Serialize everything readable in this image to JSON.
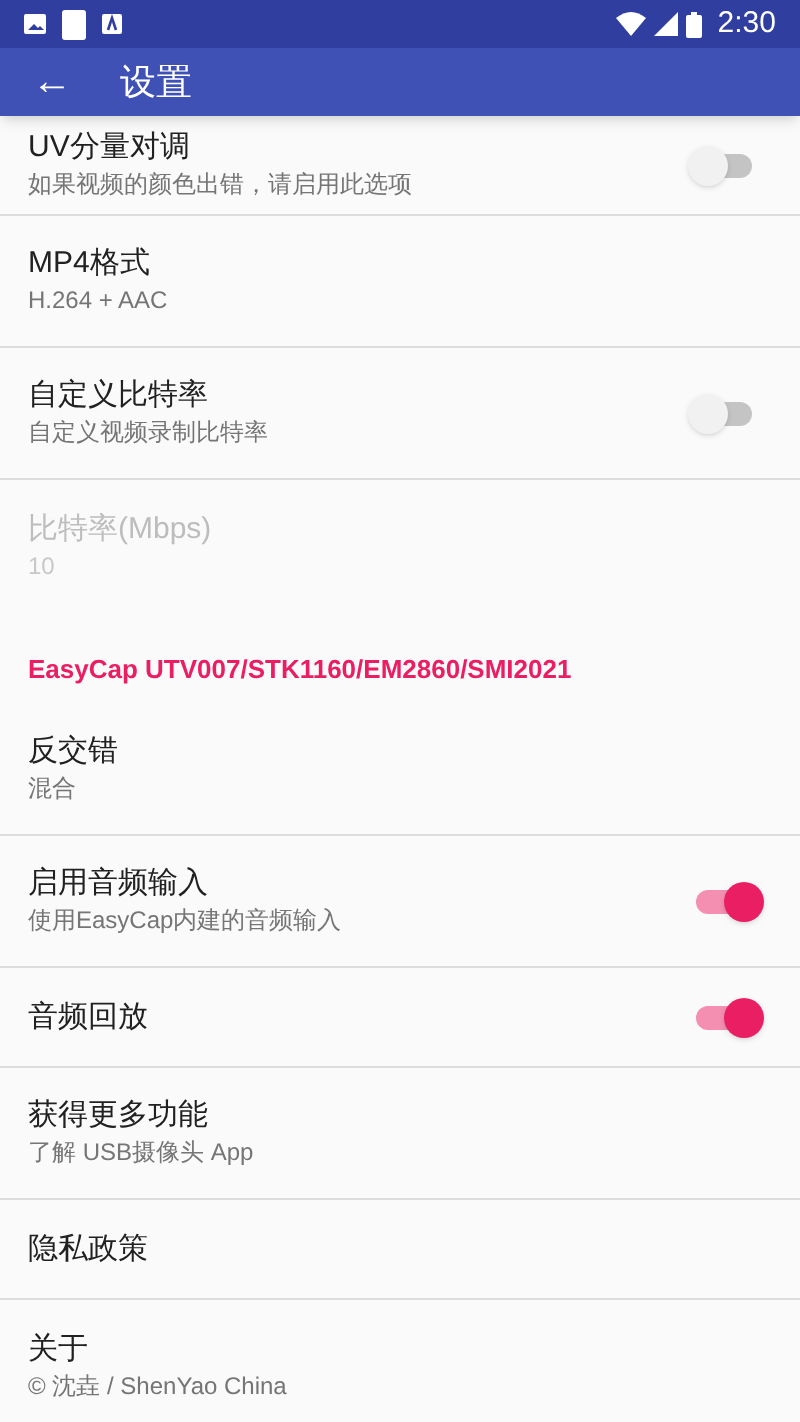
{
  "status_bar": {
    "time": "2:30"
  },
  "app_bar": {
    "back": "←",
    "title": "设置"
  },
  "items": [
    {
      "kind": "switch",
      "title": "UV分量对调",
      "summary": "如果视频的颜色出错，请启用此选项",
      "on": false,
      "disabled": false
    },
    {
      "kind": "text",
      "title": "MP4格式",
      "summary": "H.264 + AAC",
      "disabled": false
    },
    {
      "kind": "switch",
      "title": "自定义比特率",
      "summary": "自定义视频录制比特率",
      "on": false,
      "disabled": false
    },
    {
      "kind": "text",
      "title": "比特率(Mbps)",
      "summary": "10",
      "disabled": true
    },
    {
      "kind": "category",
      "title": "EasyCap UTV007/STK1160/EM2860/SMI2021"
    },
    {
      "kind": "text",
      "title": "反交错",
      "summary": "混合",
      "disabled": false
    },
    {
      "kind": "switch",
      "title": "启用音频输入",
      "summary": "使用EasyCap内建的音频输入",
      "on": true,
      "disabled": false
    },
    {
      "kind": "switch",
      "title": "音频回放",
      "on": true,
      "disabled": false
    },
    {
      "kind": "text",
      "title": "获得更多功能",
      "summary": "了解 USB摄像头 App",
      "disabled": false
    },
    {
      "kind": "text",
      "title": "隐私政策",
      "disabled": false
    },
    {
      "kind": "text",
      "title": "关于",
      "summary": "© 沈垚 / ShenYao China",
      "disabled": false
    }
  ]
}
